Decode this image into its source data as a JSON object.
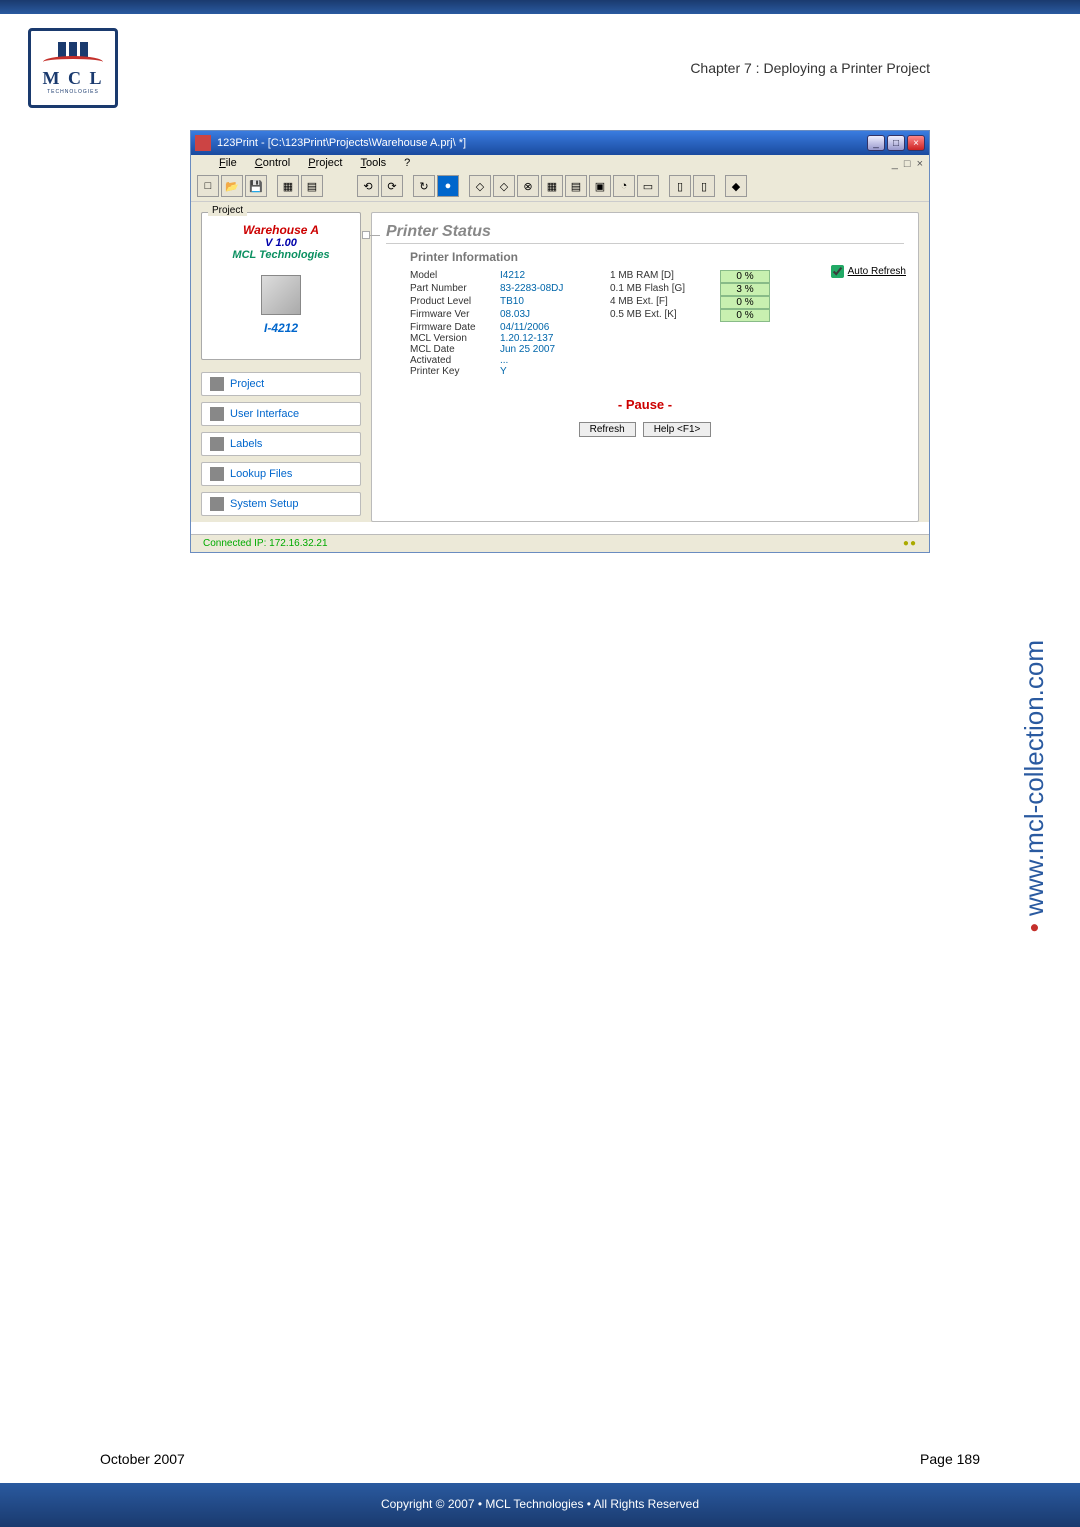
{
  "page": {
    "chapter_header": "Chapter 7 : Deploying a Printer Project",
    "date": "October 2007",
    "page_num": "Page 189",
    "copyright": "Copyright © 2007 • MCL Technologies • All Rights Reserved",
    "side_url": "www.mcl-collection.com"
  },
  "logo": {
    "txt": "M C L",
    "sub": "TECHNOLOGIES"
  },
  "window": {
    "title": "123Print - [C:\\123Print\\Projects\\Warehouse A.prj\\ *]",
    "menu": {
      "file": "File",
      "control": "Control",
      "project": "Project",
      "tools": "Tools",
      "help": "?"
    }
  },
  "project": {
    "tab": "Project",
    "name": "Warehouse A",
    "version": "V 1.00",
    "tech": "MCL Technologies",
    "model": "I-4212"
  },
  "nav": {
    "project": "Project",
    "ui": "User Interface",
    "labels": "Labels",
    "lookup": "Lookup Files",
    "sys": "System Setup"
  },
  "printer": {
    "title": "Printer Status",
    "sub": "Printer Information",
    "auto": "Auto Refresh",
    "info": {
      "model_l": "Model",
      "model_v": "I4212",
      "part_l": "Part Number",
      "part_v": "83-2283-08DJ",
      "prod_l": "Product Level",
      "prod_v": "TB10",
      "fw_l": "Firmware Ver",
      "fw_v": "08.03J",
      "fwd_l": "Firmware Date",
      "fwd_v": "04/11/2006",
      "mclv_l": "MCL Version",
      "mclv_v": "1.20.12-137",
      "mcld_l": "MCL Date",
      "mcld_v": "Jun 25 2007",
      "act_l": "Activated",
      "act_v": "...",
      "key_l": "Printer Key",
      "key_v": "Y"
    },
    "mem": {
      "ram_l": "1 MB RAM [D]",
      "ram_v": "0 %",
      "flash_l": "0.1 MB Flash [G]",
      "flash_v": "3 %",
      "extf_l": "4 MB Ext. [F]",
      "extf_v": "0 %",
      "extk_l": "0.5 MB Ext. [K]",
      "extk_v": "0 %"
    },
    "pause": "- Pause -",
    "refresh": "Refresh",
    "help": "Help <F1>"
  },
  "status": {
    "ip": "Connected IP: 172.16.32.21"
  }
}
